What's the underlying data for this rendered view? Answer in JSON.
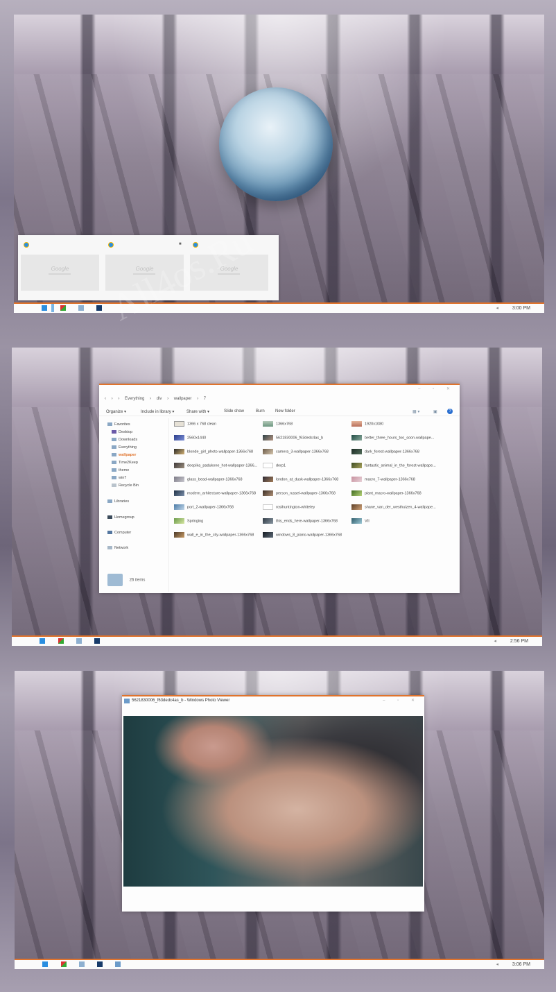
{
  "watermark": "All4os.Ru",
  "shot1": {
    "clock": "3:00 PM",
    "thumbnails": [
      {
        "logo": "Google"
      },
      {
        "logo": "Google"
      },
      {
        "logo": "Google"
      }
    ]
  },
  "shot2": {
    "clock": "2:56 PM",
    "address": [
      "Everything",
      "div",
      "wallpaper",
      "7"
    ],
    "toolbar": [
      "Organize ▾",
      "Include in library ▾",
      "Share with ▾",
      "Slide show",
      "Burn",
      "New folder"
    ],
    "nav": {
      "favorites": "Favorites",
      "desktop": "Desktop",
      "downloads": "Downloads",
      "everything": "Everything",
      "wallpaper": "wallpaper",
      "time2keep": "Time2Keep",
      "theme": "theme",
      "win7": "win7",
      "recycle": "Recycle Bin",
      "libraries": "Libraries",
      "homegroup": "Homegroup",
      "computer": "Computer",
      "network": "Network"
    },
    "files": [
      "1366 x 768 clean",
      "1366x768",
      "1920x1080",
      "2560x1440",
      "5621830006_f63dedc4as_b",
      "better_three_hours_too_soon-wallpape...",
      "blonde_girl_photo-wallpaper-1366x768",
      "camera_3-wallpaper-1366x768",
      "dark_forest-wallpaper-1366x768",
      "deepika_padukone_hot-wallpaper-1366...",
      "derp1",
      "fantastic_animal_in_the_forest-wallpape...",
      "glass_bead-wallpaper-1366x768",
      "london_at_dusk-wallpaper-1366x768",
      "macro_7-wallpaper-1366x768",
      "modern_arhitecture-wallpaper-1366x768",
      "person_russel-wallpaper-1366x768",
      "plant_macro-wallpaper-1366x768",
      "port_2-wallpaper-1366x768",
      "rosihuntington-whiteley",
      "shane_van_der_westhuizen_4-wallpape...",
      "Springing",
      "this_ends_here-wallpaper-1366x768",
      "VII",
      "wall_e_in_the_city-wallpaper-1366x768",
      "windows_8_piano-wallpaper-1366x768"
    ],
    "status": "26 items"
  },
  "shot3": {
    "clock": "3:06 PM",
    "title": "5621830006_f63dedc4as_b - Windows Photo Viewer"
  },
  "colors": {
    "accent": "#e0732c",
    "window": "#fdfdfd"
  }
}
